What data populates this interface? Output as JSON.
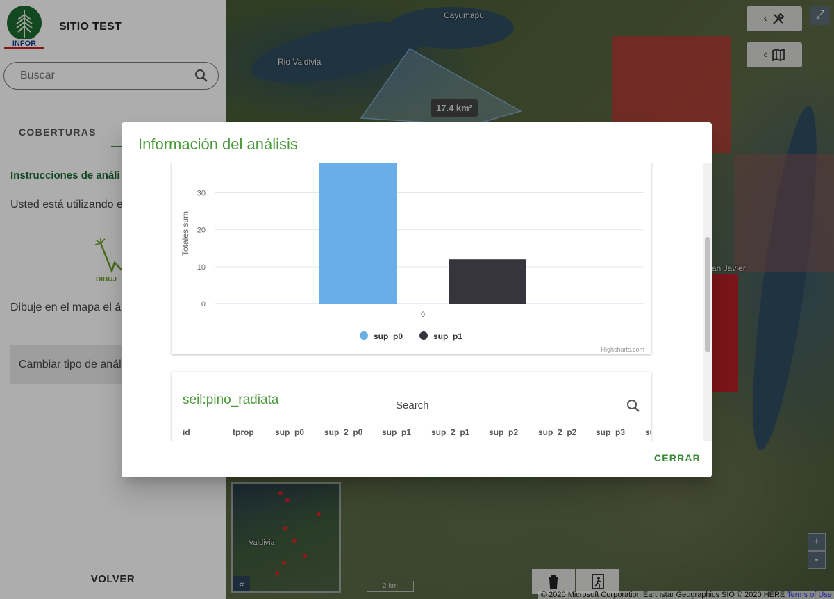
{
  "sidebar": {
    "logo_text": "INFOR",
    "site_title": "SITIO TEST",
    "search_placeholder": "Buscar",
    "tabs": [
      {
        "label": "COBERTURAS"
      }
    ],
    "instructions_title": "Instrucciones de análi",
    "instructions_text": "Usted está utilizando e análisis tipo:",
    "draw_label": "DIBUJ",
    "instructions_text2": "Dibuje en el mapa el ár analizar.",
    "change_button": "Cambiar tipo de anál",
    "back_button": "VOLVER"
  },
  "map": {
    "labels": {
      "cayumapu": "Cayumapu",
      "rio_valdivia": "Rio Valdivia",
      "san_javier": "an Javier",
      "valdivia": "Valdivia"
    },
    "area_badge": "17.4 km²",
    "scale": "2 km",
    "zoom_in": "+",
    "zoom_out": "-",
    "attribution": "© 2020 Microsoft Corporation Earthstar Geographics SIO © 2020 HERE",
    "attribution_link": "Terms of Use",
    "overview_collapse": "«"
  },
  "dialog": {
    "title": "Información del análisis",
    "close_button": "CERRAR",
    "layer_title": "seil:pino_radiata",
    "search_placeholder": "Search",
    "columns": [
      "id",
      "tprop",
      "sup_p0",
      "sup_2_p0",
      "sup_p1",
      "sup_2_p1",
      "sup_p2",
      "sup_2_p2",
      "sup_p3",
      "su"
    ]
  },
  "chart_data": {
    "type": "bar",
    "categories": [
      "0"
    ],
    "series": [
      {
        "name": "sup_p0",
        "values": [
          40
        ],
        "color": "#6aaee8"
      },
      {
        "name": "sup_p1",
        "values": [
          12
        ],
        "color": "#36353d"
      }
    ],
    "ylabel": "Totales sum",
    "ylim": [
      0,
      38
    ],
    "yticks": [
      0,
      10,
      20,
      30
    ],
    "credits": "Highcharts.com",
    "legend_position": "bottom"
  },
  "colors": {
    "accent": "#4a9a3a",
    "dark_green": "#1b6b2e"
  }
}
